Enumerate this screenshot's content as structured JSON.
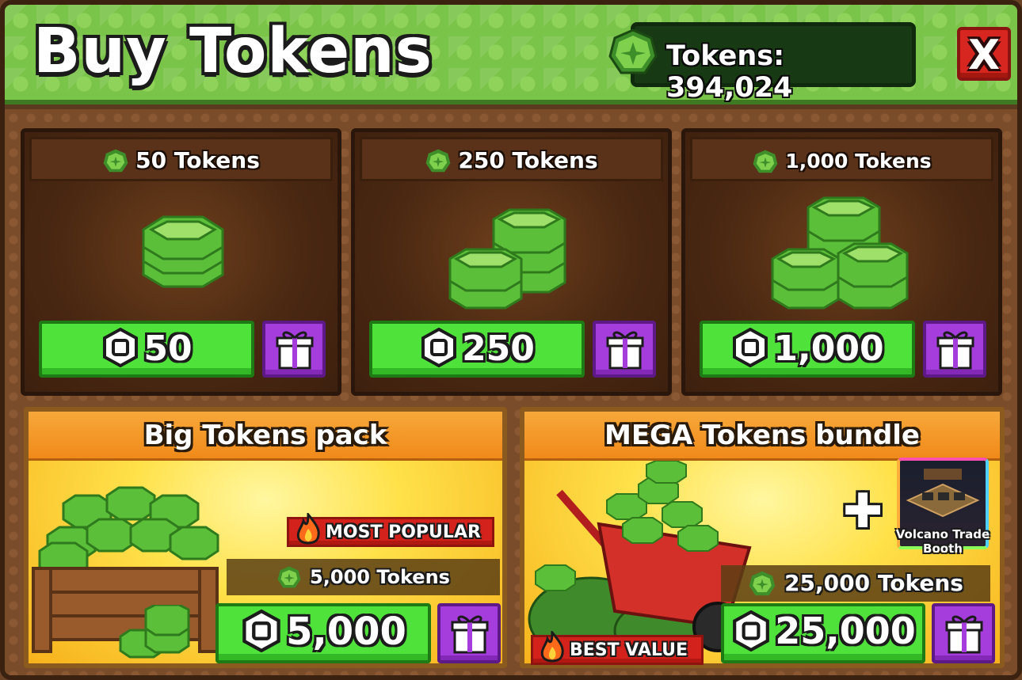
{
  "header": {
    "title": "Buy Tokens",
    "balance_label": "Tokens: 394,024",
    "close_label": "X"
  },
  "cards": [
    {
      "title": "50 Tokens",
      "price": "50"
    },
    {
      "title": "250 Tokens",
      "price": "250"
    },
    {
      "title": "1,000 Tokens",
      "price": "1,000"
    }
  ],
  "big_pack": {
    "title": "Big Tokens pack",
    "badge": "MOST POPULAR",
    "amount": "5,000 Tokens",
    "price": "5,000"
  },
  "mega_bundle": {
    "title": "MEGA Tokens bundle",
    "badge": "BEST VALUE",
    "amount": "25,000 Tokens",
    "price": "25,000",
    "bonus_item": "Volcano Trade Booth"
  },
  "colors": {
    "header_green": "#7bc44a",
    "buy_green": "#4fe23a",
    "gift_purple": "#a53cdc",
    "close_red": "#d7251f",
    "ribbon_red": "#d3221c",
    "panel_orange": "#f08a1a"
  },
  "icons": [
    "token-icon",
    "robux-icon",
    "gift-icon",
    "fire-icon",
    "close-icon",
    "plus-icon"
  ]
}
